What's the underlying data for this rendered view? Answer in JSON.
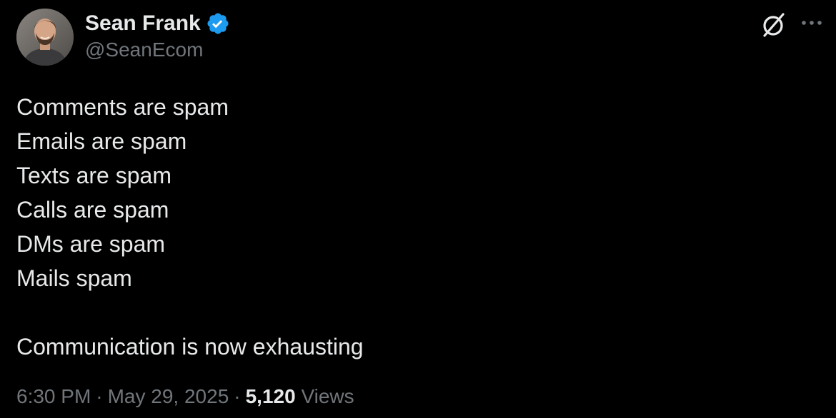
{
  "author": {
    "display_name": "Sean Frank",
    "handle": "@SeanEcom",
    "verified": true,
    "verified_color": "#1d9bf0",
    "avatar_icon": "profile-photo"
  },
  "header_icons": {
    "grok": "grok-icon",
    "more": "more-options-icon"
  },
  "tweet": {
    "lines": [
      "Comments are spam",
      "Emails are spam",
      "Texts are spam",
      "Calls are spam",
      "DMs are spam",
      "Mails spam",
      "",
      "Communication is now exhausting"
    ]
  },
  "meta": {
    "time": "6:30 PM",
    "separator": "·",
    "date": "May 29, 2025",
    "views_count": "5,120",
    "views_label": "Views"
  },
  "colors": {
    "background": "#000000",
    "primary_text": "#e7e9ea",
    "secondary_text": "#71767b"
  }
}
